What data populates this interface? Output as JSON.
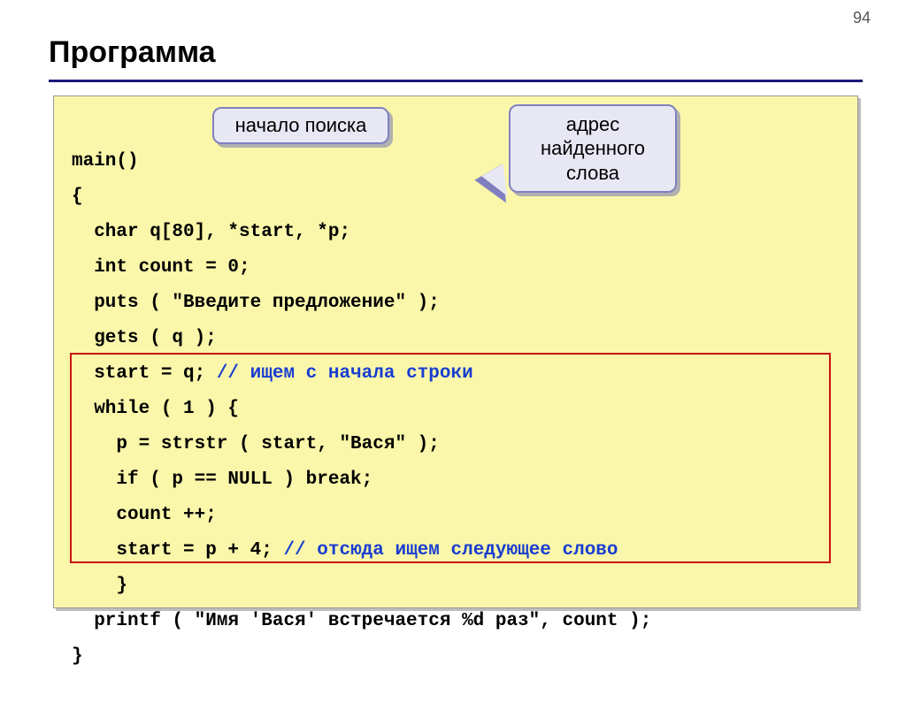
{
  "page_number": "94",
  "title": "Программа",
  "callout1": "начало поиска",
  "callout2_line1": "адрес",
  "callout2_line2": "найденного",
  "callout2_line3": "слова",
  "code": {
    "l1": "main()",
    "l2": "{",
    "l3": "  char q[80], *start, *p;",
    "l4": "  int count = 0;",
    "l5": "  puts ( \"Введите предложение\" );",
    "l6": "  gets ( q );",
    "l7a": "  start = q; ",
    "l7b": "// ищем с начала строки",
    "l8": "  while ( 1 ) {",
    "l9": "    p = strstr ( start, \"Вася\" );",
    "l10": "    if ( p == NULL ) break;",
    "l11": "    count ++;",
    "l12a": "    start = p + 4; ",
    "l12b": "// отсюда ищем следующее слово",
    "l13": "    }",
    "l14": "  printf ( \"Имя 'Вася' встречается %d раз\", count );",
    "l15": "}"
  }
}
